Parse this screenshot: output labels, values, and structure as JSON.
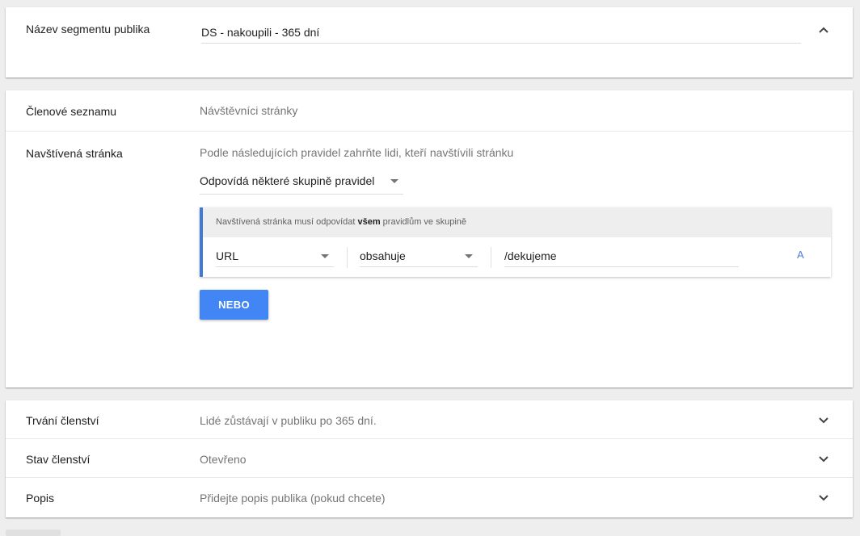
{
  "segment_name": {
    "label": "Název segmentu publika",
    "value": "DS - nakoupili - 365 dní"
  },
  "list_members": {
    "label": "Členové seznamu",
    "value": "Návštěvníci stránky"
  },
  "visited_page": {
    "label": "Navštívená stránka",
    "description": "Podle následujících pravidel zahrňte lidi, kteří navštívili stránku",
    "match_mode": "Odpovídá některé skupině pravidel",
    "rule_group": {
      "header_prefix": "Navštívená stránka musí odpovídat ",
      "header_bold": "všem",
      "header_suffix": " pravidlům ve skupině",
      "field": "URL",
      "operator": "obsahuje",
      "value": "/dekujeme",
      "case_toggle": "A"
    },
    "or_button": "NEBO"
  },
  "settings": [
    {
      "label": "Trvání členství",
      "value": "Lidé zůstávají v publiku po 365 dní."
    },
    {
      "label": "Stav členství",
      "value": "Otevřeno"
    },
    {
      "label": "Popis",
      "value": "Přidejte popis publika (pokud chcete)"
    }
  ],
  "icons": {
    "collapse": "chevron-up-icon",
    "expand": "chevron-down-icon",
    "dropdown": "caret-down-icon"
  },
  "colors": {
    "accent": "#4285f4",
    "rule_border": "#3f7ad9"
  }
}
